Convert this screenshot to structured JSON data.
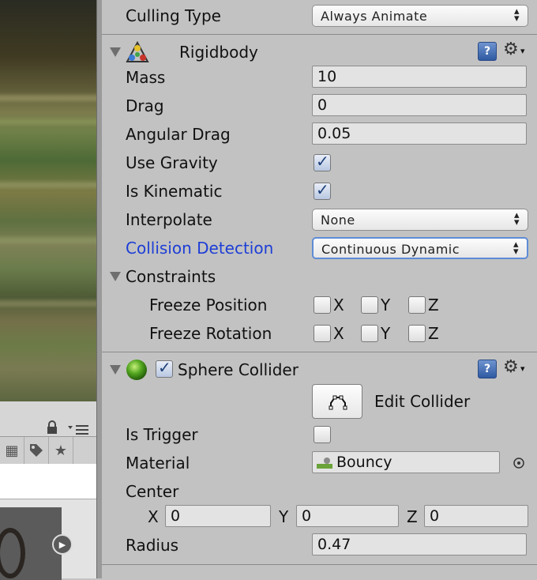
{
  "inspector": {
    "culling": {
      "label": "Culling Type",
      "value": "Always Animate"
    },
    "rigidbody": {
      "title": "Rigidbody",
      "mass": {
        "label": "Mass",
        "value": "10"
      },
      "drag": {
        "label": "Drag",
        "value": "0"
      },
      "angular_drag": {
        "label": "Angular Drag",
        "value": "0.05"
      },
      "use_gravity": {
        "label": "Use Gravity",
        "checked": true
      },
      "is_kinematic": {
        "label": "Is Kinematic",
        "checked": true
      },
      "interpolate": {
        "label": "Interpolate",
        "value": "None"
      },
      "collision_detection": {
        "label": "Collision Detection",
        "value": "Continuous Dynamic"
      },
      "constraints": {
        "label": "Constraints",
        "freeze_position": {
          "label": "Freeze Position",
          "x": "X",
          "y": "Y",
          "z": "Z"
        },
        "freeze_rotation": {
          "label": "Freeze Rotation",
          "x": "X",
          "y": "Y",
          "z": "Z"
        }
      }
    },
    "sphere_collider": {
      "title": "Sphere Collider",
      "enabled": true,
      "edit_collider_label": "Edit Collider",
      "is_trigger": {
        "label": "Is Trigger",
        "checked": false
      },
      "material": {
        "label": "Material",
        "value": "Bouncy"
      },
      "center": {
        "label": "Center",
        "x_label": "X",
        "x": "0",
        "y_label": "Y",
        "y": "0",
        "z_label": "Z",
        "z": "0"
      },
      "radius": {
        "label": "Radius",
        "value": "0.47"
      }
    },
    "icons": [
      "help-book-icon",
      "gear-icon",
      "rigidbody-icon",
      "sphere-collider-icon",
      "object-picker-icon"
    ]
  },
  "colors": {
    "highlight_label": "#1d3ed6",
    "panel_bg": "#c2c2c2",
    "field_bg": "#e3e3e3"
  }
}
